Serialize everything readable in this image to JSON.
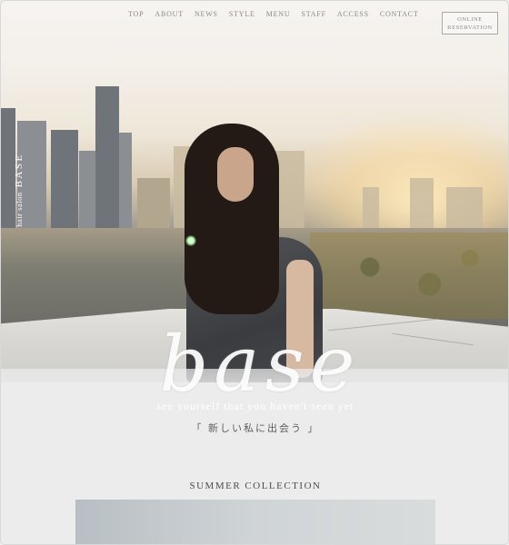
{
  "nav": {
    "items": [
      "TOP",
      "ABOUT",
      "NEWS",
      "STYLE",
      "MENU",
      "STAFF",
      "ACCESS",
      "CONTACT"
    ]
  },
  "reservation": {
    "line1": "ONLINE",
    "line2": "RESERVATION"
  },
  "brand": {
    "prefix": "hair salon",
    "name": "BASE"
  },
  "hero": {
    "logo_text": "base",
    "tagline": "see yourself that you haven't seen yet",
    "jp_catch": "「 新しい私に出会う 」"
  },
  "section": {
    "title": "SUMMER  COLLECTION"
  },
  "colors": {
    "nav_text": "#8a8a8a",
    "logo": "#ffffff",
    "body_text": "#4d4d4d"
  }
}
